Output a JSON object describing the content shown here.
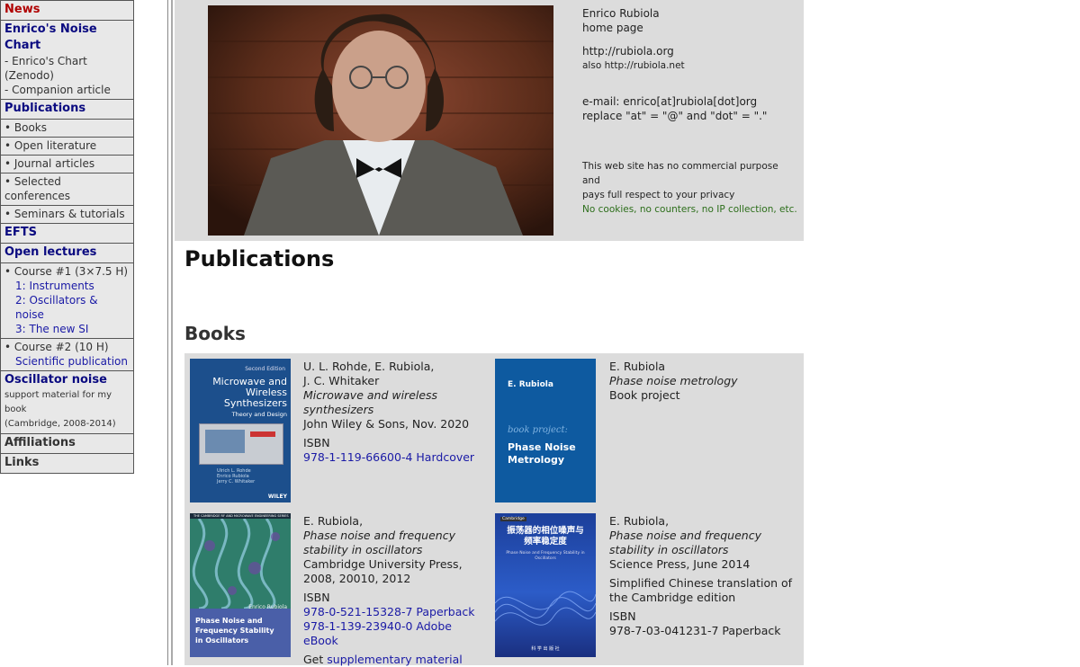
{
  "sidebar": {
    "news": "News",
    "noise_chart": "Enrico's Noise Chart",
    "noise_chart_zenodo": "- Enrico's Chart (Zenodo)",
    "noise_chart_article": "- Companion article",
    "publications": "Publications",
    "pub_items": [
      "• Books",
      "• Open literature",
      "• Journal articles",
      "• Selected conferences",
      "• Seminars & tutorials"
    ],
    "efts": "EFTS",
    "open_lectures": "Open lectures",
    "course1": "• Course #1 (3×7.5 H)",
    "course1_links": [
      "1: Instruments",
      "2: Oscillators & noise",
      "3: The new SI"
    ],
    "course2": "• Course #2 (10 H)",
    "course2_link": "Scientific publication",
    "osc_noise": "Oscillator noise",
    "osc_noise_desc1": "support material for my book",
    "osc_noise_desc2": "(Cambridge, 2008-2014)",
    "affiliations": "Affiliations",
    "links": "Links"
  },
  "header": {
    "name": "Enrico Rubiola",
    "home": "home page",
    "url": "http://rubiola.org",
    "url_also": "also http://rubiola.net",
    "email": "e-mail: enrico[at]rubiola[dot]org",
    "email_note": "replace \"at\" = \"@\" and \"dot\" = \".\"",
    "notice1": "This web site has no commercial purpose and",
    "notice2": "pays full respect to your privacy",
    "notice3": "No cookies, no counters, no IP collection, etc."
  },
  "main": {
    "title": "Publications",
    "books_title": "Books"
  },
  "books": [
    {
      "authors1": "U. L. Rohde, E. Rubiola,",
      "authors2": "J. C. Whitaker",
      "title1": "Microwave and wireless",
      "title2": "synthesizers",
      "publisher": "John Wiley & Sons, Nov. 2020",
      "isbn_label": "ISBN",
      "isbn1": "978-1-119-66600-4 Hardcover",
      "cover": {
        "top": "Second Edition",
        "title1": "Microwave and",
        "title2": "Wireless",
        "title3": "Synthesizers",
        "sub": "Theory and Design",
        "authors": "Ulrich L. Rohde\nEnrico Rubiola\nJerry C. Whitaker",
        "brand": "WILEY"
      }
    },
    {
      "authors1": "E. Rubiola",
      "title1": "Phase noise metrology",
      "note": "Book project",
      "cover": {
        "author": "E. Rubiola",
        "project": "book project:",
        "title1": "Phase Noise",
        "title2": "Metrology"
      }
    },
    {
      "authors1": "E. Rubiola,",
      "title1": "Phase noise and frequency",
      "title2": "stability in oscillators",
      "publisher1": "Cambridge University Press,",
      "publisher2": "2008, 20010, 2012",
      "isbn_label": "ISBN",
      "isbn1": "978-0-521-15328-7 Paperback",
      "isbn2": "978-1-139-23940-0 Adobe eBook",
      "supp_prefix": "Get",
      "supp_link": "supplementary material",
      "cover": {
        "series": "THE CAMBRIDGE RF AND MICROWAVE ENGINEERING SERIES",
        "author": "Enrico Rubiola",
        "title1": "Phase Noise and",
        "title2": "Frequency Stability",
        "title3": "in Oscillators"
      }
    },
    {
      "authors1": "E. Rubiola,",
      "title1": "Phase noise and frequency",
      "title2": "stability in oscillators",
      "publisher": "Science Press, June 2014",
      "note1": "Simplified Chinese translation of",
      "note2": "the Cambridge edition",
      "isbn_label": "ISBN",
      "isbn1": "978-7-03-041231-7 Paperback",
      "cover": {
        "brand": "Cambridge",
        "title1": "振荡器的相位噪声与",
        "title2": "频率稳定度",
        "sub": "Phase Noise and Frequency Stability in Oscillators",
        "bottom": "科 学 出 版 社"
      }
    }
  ],
  "colors": {
    "accent_link": "#1a1aa6",
    "news_red": "#b00000",
    "nav_heading": "#0a0a80",
    "privacy_green": "#2c6e1a",
    "panel_gray": "#dcdcdc"
  }
}
